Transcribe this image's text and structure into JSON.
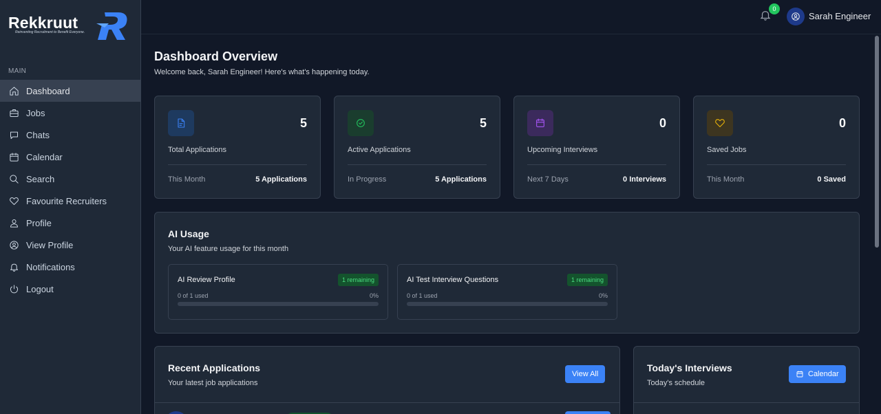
{
  "brand": {
    "name": "Rekkruut",
    "tagline": "Reinventing Recruitment to Benefit Everyone."
  },
  "sidebar": {
    "section_label": "MAIN",
    "items": [
      {
        "label": "Dashboard",
        "icon": "home-icon",
        "active": true
      },
      {
        "label": "Jobs",
        "icon": "briefcase-icon"
      },
      {
        "label": "Chats",
        "icon": "chat-icon"
      },
      {
        "label": "Calendar",
        "icon": "calendar-icon"
      },
      {
        "label": "Search",
        "icon": "search-icon"
      },
      {
        "label": "Favourite Recruiters",
        "icon": "heart-icon"
      },
      {
        "label": "Profile",
        "icon": "user-icon"
      },
      {
        "label": "View Profile",
        "icon": "user-circle-icon"
      },
      {
        "label": "Notifications",
        "icon": "bell-icon"
      },
      {
        "label": "Logout",
        "icon": "logout-icon"
      }
    ]
  },
  "topbar": {
    "notification_count": "0",
    "user_name": "Sarah Engineer"
  },
  "main": {
    "title": "Dashboard Overview",
    "subtitle": "Welcome back, Sarah Engineer! Here's what's happening today.",
    "stats": [
      {
        "value": "5",
        "label": "Total Applications",
        "foot_left": "This Month",
        "foot_right": "5 Applications",
        "icon": "document-icon",
        "color": "#3b82f6"
      },
      {
        "value": "5",
        "label": "Active Applications",
        "foot_left": "In Progress",
        "foot_right": "5 Applications",
        "icon": "check-circle-icon",
        "color": "#22c55e"
      },
      {
        "value": "0",
        "label": "Upcoming Interviews",
        "foot_left": "Next 7 Days",
        "foot_right": "0 Interviews",
        "icon": "calendar-icon",
        "color": "#a855f7"
      },
      {
        "value": "0",
        "label": "Saved Jobs",
        "foot_left": "This Month",
        "foot_right": "0 Saved",
        "icon": "heart-icon",
        "color": "#eab308"
      }
    ],
    "ai_usage": {
      "title": "AI Usage",
      "subtitle": "Your AI feature usage for this month",
      "items": [
        {
          "name": "AI Review Profile",
          "remaining": "1 remaining",
          "used": "0 of 1 used",
          "percent": "0%",
          "fraction": 0
        },
        {
          "name": "AI Test Interview Questions",
          "remaining": "1 remaining",
          "used": "0 of 1 used",
          "percent": "0%",
          "fraction": 0
        }
      ]
    },
    "recent": {
      "title": "Recent Applications",
      "subtitle": "Your latest job applications",
      "button": "View All"
    },
    "today": {
      "title": "Today's Interviews",
      "subtitle": "Today's schedule",
      "button": "Calendar"
    }
  }
}
